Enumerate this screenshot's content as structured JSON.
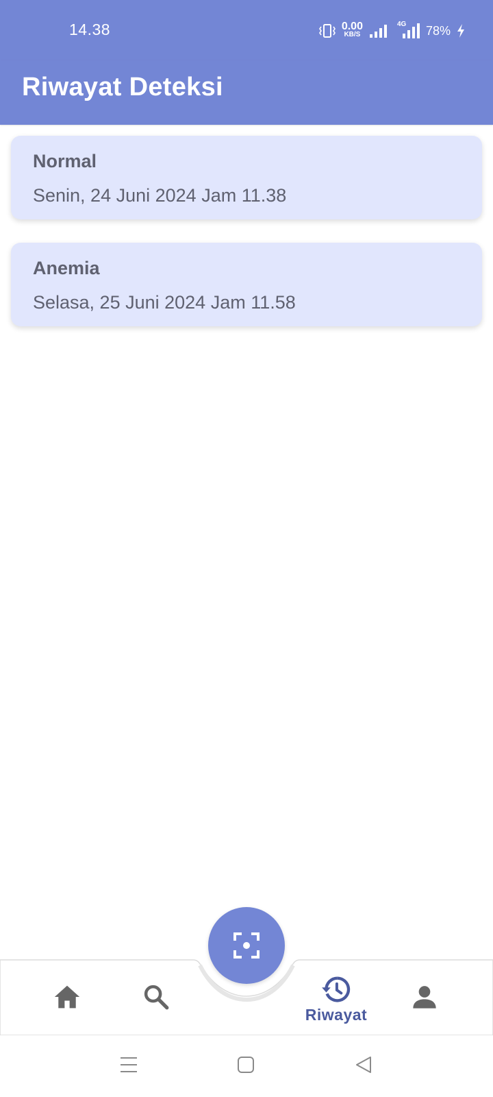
{
  "status_bar": {
    "time": "14.38",
    "net_speed_value": "0.00",
    "net_speed_unit": "KB/S",
    "network_type": "4G",
    "battery": "78%"
  },
  "app_bar": {
    "title": "Riwayat Deteksi"
  },
  "history": [
    {
      "result": "Normal",
      "datetime": "Senin, 24 Juni 2024 Jam 11.38"
    },
    {
      "result": "Anemia",
      "datetime": "Selasa, 25 Juni 2024 Jam 11.58"
    }
  ],
  "bottom_nav": {
    "items": [
      {
        "icon": "home-icon",
        "label": ""
      },
      {
        "icon": "search-icon",
        "label": ""
      },
      {
        "icon": "history-icon",
        "label": "Riwayat",
        "active": true
      },
      {
        "icon": "person-icon",
        "label": ""
      }
    ],
    "fab_icon": "scan-focus-icon"
  },
  "colors": {
    "primary": "#7386d5",
    "card_bg": "#e1e6fd",
    "active_nav": "#4a5a9e",
    "inactive_icon": "#666666"
  }
}
